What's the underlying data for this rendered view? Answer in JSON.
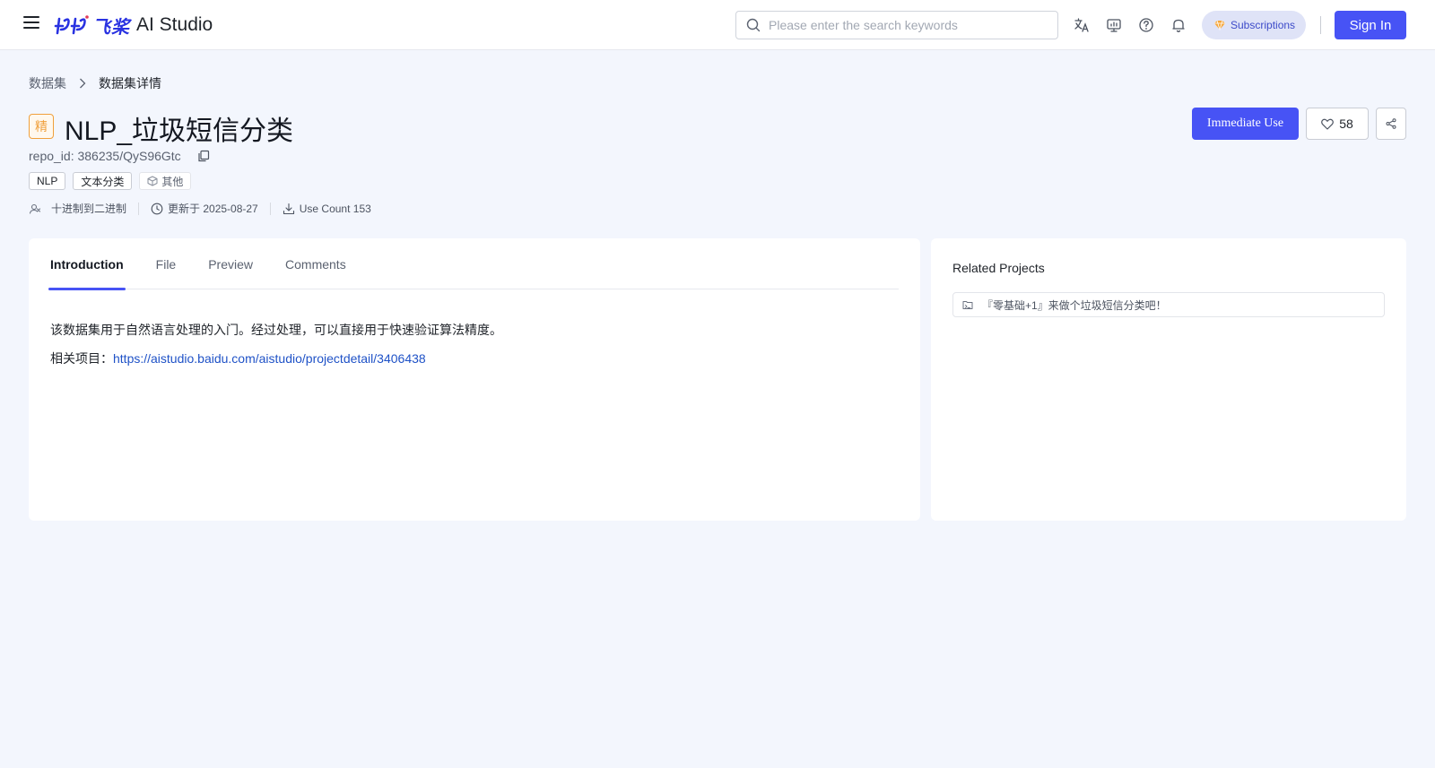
{
  "header": {
    "logo_cn": "飞桨",
    "logo_en": "AI Studio",
    "search_placeholder": "Please enter the search keywords",
    "subscriptions_label": "Subscriptions",
    "signin_label": "Sign In",
    "icons": [
      "translate-icon",
      "monitor-icon",
      "help-icon",
      "bell-icon"
    ]
  },
  "breadcrumb": {
    "parent": "数据集",
    "current": "数据集详情"
  },
  "dataset": {
    "badge": "精",
    "title": "NLP_垃圾短信分类",
    "repo_id": "repo_id: 386235/QyS96Gtc",
    "tags": [
      "NLP",
      "文本分类"
    ],
    "other_tag": "其他",
    "author": "十进制到二进制",
    "updated": "更新于 2025-08-27",
    "use_count": "Use Count 153"
  },
  "actions": {
    "use_label": "Immediate Use",
    "like_count": "58"
  },
  "tabs": [
    "Introduction",
    "File",
    "Preview",
    "Comments"
  ],
  "intro": {
    "line1": "该数据集用于自然语言处理的入门。经过处理，可以直接用于快速验证算法精度。",
    "line2_prefix": "相关项目：",
    "line2_link": "https://aistudio.baidu.com/aistudio/projectdetail/3406438"
  },
  "related": {
    "title": "Related Projects",
    "items": [
      "『零基础+1』来做个垃圾短信分类吧！"
    ]
  },
  "colors": {
    "primary": "#4753f5",
    "badge_orange": "#f0a03c",
    "link": "#1f52c7"
  }
}
